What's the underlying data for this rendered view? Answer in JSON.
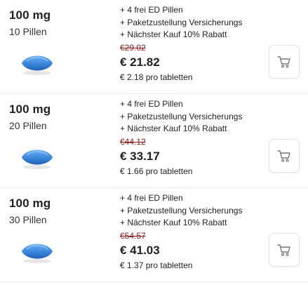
{
  "colors": {
    "pill_top": "#5aa3ee",
    "pill_bottom": "#2a6fc6",
    "old_price": "#8a1a1a",
    "cart_icon": "#777777"
  },
  "icons": {
    "pill": "pill-icon",
    "cart": "shopping-cart-icon"
  },
  "offers": [
    {
      "dose": "100 mg",
      "count": "10 Pillen",
      "perks": [
        "+ 4 frei ED Pillen",
        "+ Paketzustellung Versicherungs",
        "+ Nächster Kauf 10% Rabatt"
      ],
      "old_price": "€29.02",
      "price": "€ 21.82",
      "per_unit": "€ 2.18 pro tabletten"
    },
    {
      "dose": "100 mg",
      "count": "20 Pillen",
      "perks": [
        "+ 4 frei ED Pillen",
        "+ Paketzustellung Versicherungs",
        "+ Nächster Kauf 10% Rabatt"
      ],
      "old_price": "€44.12",
      "price": "€ 33.17",
      "per_unit": "€ 1.66 pro tabletten"
    },
    {
      "dose": "100 mg",
      "count": "30 Pillen",
      "perks": [
        "+ 4 frei ED Pillen",
        "+ Paketzustellung Versicherungs",
        "+ Nächster Kauf 10% Rabatt"
      ],
      "old_price": "€54.57",
      "price": "€ 41.03",
      "per_unit": "€ 1.37 pro tabletten"
    }
  ]
}
